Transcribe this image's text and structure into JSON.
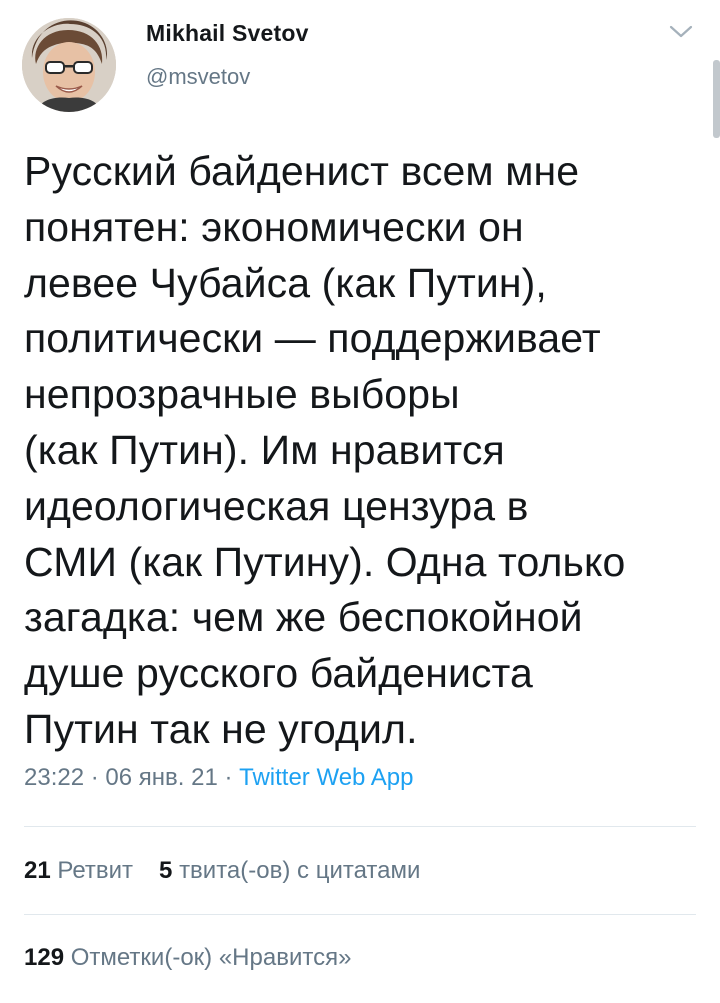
{
  "author": {
    "name": "Mikhail Svetov",
    "handle": "@msvetov"
  },
  "tweet": {
    "text": "Русский байденист всем мне\nпонятен: экономически он\nлевее Чубайса (как Путин),\nполитически — поддерживает\nнепрозрачные выборы\n(как Путин). Им нравится\nидеологическая цензура в\nСМИ (как Путину). Одна только\nзагадка: чем же беспокойной\nдуше русского байдениста\nПутин так не угодил.",
    "time": "23:22",
    "date": "06 янв. 21",
    "separator": " · ",
    "source": "Twitter Web App"
  },
  "stats": {
    "retweets_count": "21",
    "retweets_label": "Ретвит",
    "quotes_count": "5",
    "quotes_label": "твита(-ов) с цитатами",
    "likes_count": "129",
    "likes_label": "Отметки(-ок) «Нравится»"
  },
  "icons": {
    "menu": "chevron-down-icon"
  },
  "colors": {
    "text": "#14171a",
    "secondary": "#657786",
    "link": "#1da1f2",
    "divider": "#e1e8ed"
  }
}
